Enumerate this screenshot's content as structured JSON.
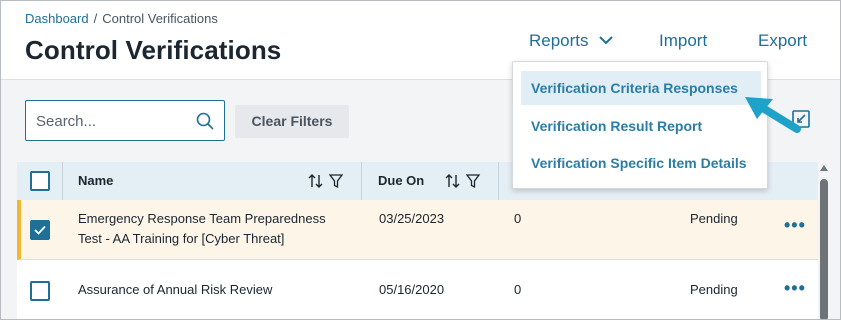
{
  "breadcrumb": {
    "home": "Dashboard",
    "separator": "/",
    "current": "Control Verifications"
  },
  "page": {
    "title": "Control Verifications"
  },
  "toolbar": {
    "reports_label": "Reports",
    "import_label": "Import",
    "export_label": "Export"
  },
  "reports_menu": {
    "items": [
      {
        "label": "Verification Criteria Responses",
        "highlighted": true
      },
      {
        "label": "Verification Result Report"
      },
      {
        "label": "Verification Specific Item Details"
      }
    ]
  },
  "search": {
    "placeholder": "Search...",
    "value": ""
  },
  "filters": {
    "clear_label": "Clear Filters"
  },
  "table": {
    "columns": {
      "name": "Name",
      "due_on": "Due On"
    },
    "rows": [
      {
        "name_line1": "Emergency Response Team Preparedness",
        "name_line2": "Test - AA Training for [Cyber Threat]",
        "due_on": "03/25/2023",
        "count": "0",
        "status": "Pending",
        "selected": true
      },
      {
        "name_line1": "Assurance of Annual Risk Review",
        "due_on": "05/16/2020",
        "count": "0",
        "status": "Pending",
        "selected": false
      }
    ]
  },
  "colors": {
    "accent": "#1f6f96",
    "selected_row": "#fdf6e8",
    "selected_marker": "#f2b632",
    "pointer_arrow": "#1fa2c9",
    "header_row": "#e4eef5"
  },
  "icons": [
    "search-icon",
    "chevron-down-icon",
    "sort-icon",
    "filter-icon",
    "collapse-icon",
    "more-options-icon",
    "check-icon",
    "pointer-arrow-icon"
  ]
}
